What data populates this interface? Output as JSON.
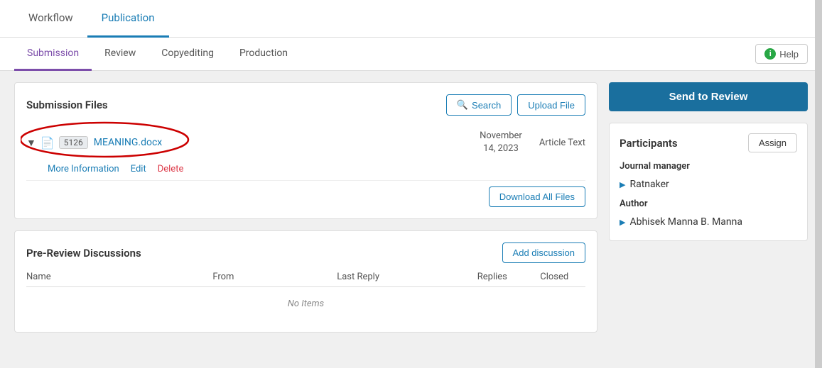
{
  "topTabs": {
    "items": [
      {
        "label": "Workflow",
        "active": false
      },
      {
        "label": "Publication",
        "active": true
      }
    ]
  },
  "subTabs": {
    "items": [
      {
        "label": "Submission",
        "active": true
      },
      {
        "label": "Review",
        "active": false
      },
      {
        "label": "Copyediting",
        "active": false
      },
      {
        "label": "Production",
        "active": false
      }
    ],
    "help_label": "Help"
  },
  "submissionFiles": {
    "title": "Submission Files",
    "search_label": "Search",
    "upload_label": "Upload File",
    "file": {
      "id": "5126",
      "name": "MEANING.docx",
      "date_line1": "November",
      "date_line2": "14, 2023",
      "type": "Article Text"
    },
    "actions": {
      "more_info": "More Information",
      "edit": "Edit",
      "delete": "Delete"
    },
    "download_all": "Download All Files"
  },
  "preReview": {
    "title": "Pre-Review Discussions",
    "add_discussion": "Add discussion",
    "columns": {
      "name": "Name",
      "from": "From",
      "last_reply": "Last Reply",
      "replies": "Replies",
      "closed": "Closed"
    },
    "no_items": "No Items"
  },
  "rightPanel": {
    "send_to_review": "Send to Review",
    "participants_title": "Participants",
    "assign_label": "Assign",
    "journal_manager_label": "Journal manager",
    "journal_manager_name": "Ratnaker",
    "author_label": "Author",
    "author_name": "Abhisek Manna B. Manna"
  },
  "icons": {
    "search": "🔍",
    "help_circle": "i",
    "chevron_down": "▼",
    "file_doc": "📄",
    "arrow_right": "▶"
  }
}
